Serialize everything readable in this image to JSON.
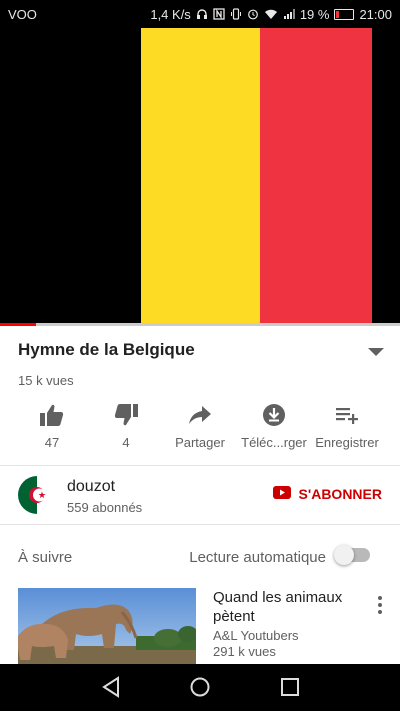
{
  "status_bar": {
    "carrier": "VOO",
    "speed": "1,4 K/s",
    "battery_text": "19 %",
    "battery_level": 0.19,
    "time": "21:00"
  },
  "video": {
    "flag_colors": [
      "#000000",
      "#FDDA24",
      "#EF3340"
    ],
    "progress": 0.09,
    "progress_color": "#FF0000"
  },
  "info": {
    "title": "Hymne de la Belgique",
    "views": "15 k vues"
  },
  "actions": [
    {
      "name": "like",
      "label": "47",
      "icon": "thumbs-up-icon"
    },
    {
      "name": "dislike",
      "label": "4",
      "icon": "thumbs-down-icon"
    },
    {
      "name": "share",
      "label": "Partager",
      "icon": "share-arrow-icon"
    },
    {
      "name": "download",
      "label": "Téléc...rger",
      "icon": "download-icon"
    },
    {
      "name": "save",
      "label": "Enregistrer",
      "icon": "playlist-add-icon"
    }
  ],
  "channel": {
    "name": "douzot",
    "subscribers": "559 abonnés",
    "subscribe_label": "S'ABONNER",
    "accent": "#CC0000"
  },
  "up_next": {
    "label": "À suivre",
    "autoplay_label": "Lecture automatique",
    "autoplay_on": false
  },
  "recommended": [
    {
      "title": "Quand les animaux pètent",
      "channel": "A&L Youtubers",
      "views": "291 k vues"
    }
  ]
}
